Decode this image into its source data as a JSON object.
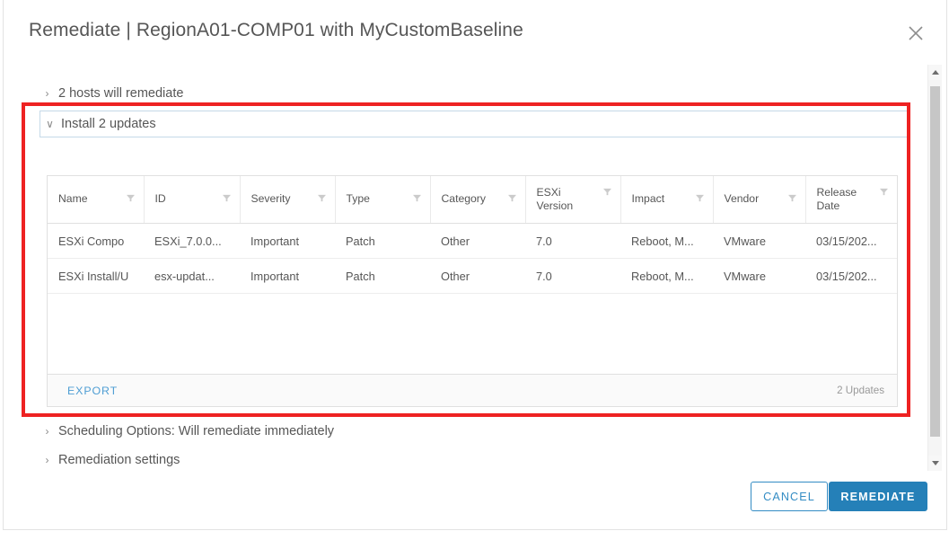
{
  "dialog": {
    "title": "Remediate | RegionA01-COMP01 with MyCustomBaseline",
    "close_label": "close-icon"
  },
  "sections": {
    "hosts": {
      "label": "2 hosts will remediate",
      "chevron": "›",
      "expanded": false
    },
    "install_updates": {
      "label": "Install 2 updates",
      "chevron": "∨",
      "expanded": true
    },
    "scheduling": {
      "label": "Scheduling Options: Will remediate immediately",
      "chevron": "›",
      "expanded": false
    },
    "remediation_settings": {
      "label": "Remediation settings",
      "chevron": "›",
      "expanded": false
    }
  },
  "updates_table": {
    "columns": [
      {
        "label": "Name",
        "filter": true
      },
      {
        "label": "ID",
        "filter": true
      },
      {
        "label": "Severity",
        "filter": true
      },
      {
        "label": "Type",
        "filter": true
      },
      {
        "label": "Category",
        "filter": true
      },
      {
        "label": "ESXi Version",
        "filter": true
      },
      {
        "label": "Impact",
        "filter": true
      },
      {
        "label": "Vendor",
        "filter": true
      },
      {
        "label": "Release Date",
        "filter": true
      }
    ],
    "rows": [
      {
        "name": "ESXi Compo",
        "id": "ESXi_7.0.0...",
        "severity": "Important",
        "type": "Patch",
        "category": "Other",
        "esxi_version": "7.0",
        "impact": "Reboot, M...",
        "vendor": "VMware",
        "release_date": "03/15/202..."
      },
      {
        "name": "ESXi Install/U",
        "id": "esx-updat...",
        "severity": "Important",
        "type": "Patch",
        "category": "Other",
        "esxi_version": "7.0",
        "impact": "Reboot, M...",
        "vendor": "VMware",
        "release_date": "03/15/202..."
      }
    ],
    "footer": {
      "export_label": "EXPORT",
      "count_label": "2 Updates"
    }
  },
  "footer": {
    "cancel_label": "CANCEL",
    "remediate_label": "REMEDIATE"
  },
  "colors": {
    "primary": "#2580b8",
    "link": "#4f9ed4",
    "annotation": "#ee2222",
    "text": "#565656"
  }
}
